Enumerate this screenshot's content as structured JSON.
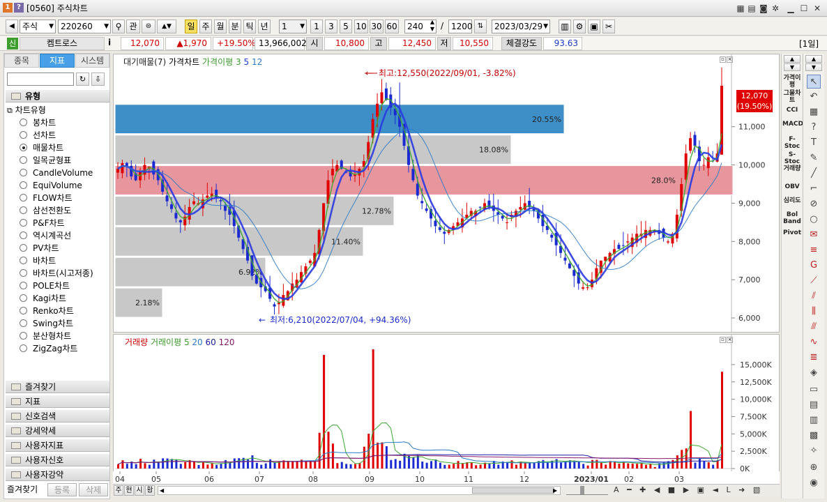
{
  "window": {
    "title": "[0560] 주식차트",
    "icon_1": "1",
    "icon_2": "?",
    "title_buttons": [
      "pin-icon",
      "save-icon",
      "camera-icon",
      "settings-icon",
      "minimize-icon",
      "maximize-icon",
      "close-icon"
    ]
  },
  "toolbar": {
    "market": "주식",
    "code": "220260",
    "search_icon": "search-icon",
    "gwan_label": "관",
    "periods": [
      "일",
      "주",
      "월",
      "분",
      "틱",
      "년"
    ],
    "active_period": "일",
    "interval_value": "1",
    "quick_intervals": [
      "1",
      "3",
      "5",
      "10",
      "30",
      "60"
    ],
    "view_count": "240",
    "slash": "/",
    "total_count": "1200",
    "date": "2023/03/29"
  },
  "info": {
    "badge": "신",
    "name": "켐트로스",
    "info_icon": "i",
    "price": "12,070",
    "change": "▲1,970",
    "change_rate": "+19.50%",
    "volume": "13,966,002",
    "open_label": "시",
    "open": "10,800",
    "high_label": "고",
    "high": "12,450",
    "low_label": "저",
    "low": "10,550",
    "strength_label": "체결강도",
    "strength": "93.63",
    "period_tag": "[1일]"
  },
  "left": {
    "tabs": [
      "종목",
      "지표",
      "시스템"
    ],
    "active_tab": "지표",
    "section_header": "유형",
    "tree_root": "차트유형",
    "chart_types": [
      "봉차트",
      "선차트",
      "매물차트",
      "일목균형표",
      "CandleVolume",
      "EquiVolume",
      "FLOW차트",
      "삼선전환도",
      "P&F차트",
      "역시계곡선",
      "PV차트",
      "바차트",
      "바차트(시고저종)",
      "POLE차트",
      "Kagi차트",
      "Renko차트",
      "Swing차트",
      "분산형차트",
      "ZigZag차트"
    ],
    "selected_type": "매물차트",
    "groups": [
      "즐겨찾기",
      "지표",
      "신호검색",
      "강세약세",
      "사용자지표",
      "사용자신호",
      "사용자강약"
    ],
    "footer_tabs": [
      "즐겨찾기",
      "등록",
      "삭제"
    ]
  },
  "price_legend": {
    "item1": "대기매물(7)",
    "item2": "가격차트",
    "ma_label": "가격이평",
    "ma1": "3",
    "ma2": "5",
    "ma3": "12"
  },
  "volume_legend": {
    "item1": "거래량",
    "ma_label": "거래이평",
    "ma1": "5",
    "ma2": "20",
    "ma3": "60",
    "ma4": "120"
  },
  "annotations": {
    "high": "최고:12,550(2022/09/01, -3.82%)",
    "low": "최저:6,210(2022/07/04, +94.36%)",
    "current_price": "12,070",
    "current_rate": "(19.50%)"
  },
  "right_tools": [
    "가격이평",
    "그물차트",
    "CCI",
    "MACD",
    "F-Stoc",
    "S-Stoc",
    "거래량",
    "OBV",
    "심리도",
    "Bol Band",
    "Pivot"
  ],
  "bottom_tabs": [
    "주",
    "현",
    "시",
    "황"
  ],
  "chart_data": [
    {
      "type": "bar",
      "name": "volume_profile",
      "categories": [
        "6,000-6,800",
        "6,800-7,600",
        "7,600-8,400",
        "8,400-9,200",
        "9,200-10,000",
        "10,000-10,800",
        "10,800-11,600"
      ],
      "values": [
        2.18,
        6.92,
        11.4,
        12.78,
        28.0,
        18.08,
        20.55
      ],
      "value_labels": [
        "2.18%",
        "6.92%",
        "11.40%",
        "12.78%",
        "28.0%",
        "18.08%",
        "20.55%"
      ],
      "highlight": [
        4,
        6
      ],
      "colors": {
        "normal": "#c8c8c8",
        "highlight_current": "#e8969e",
        "highlight_max": "#3e8ec8"
      }
    },
    {
      "type": "line",
      "name": "price",
      "x_ticks": [
        "04",
        "05",
        "06",
        "07",
        "08",
        "09",
        "10",
        "11",
        "12",
        "2023/01",
        "02",
        "03"
      ],
      "y_ticks": [
        "6,000",
        "7,000",
        "8,000",
        "9,000",
        "10,000",
        "11,000"
      ],
      "ylim": [
        5800,
        13000
      ],
      "series": [
        {
          "name": "가격차트",
          "values": [
            9900,
            10050,
            9950,
            9700,
            9600,
            9850,
            10000,
            9950,
            9750,
            9600,
            9300,
            9050,
            8850,
            8600,
            8500,
            8650,
            8900,
            9050,
            9000,
            9100,
            9200,
            9250,
            9150,
            9050,
            8800,
            8700,
            8400,
            8100,
            7800,
            7500,
            7100,
            6900,
            6800,
            6700,
            6500,
            6300,
            6400,
            6600,
            6700,
            6900,
            7000,
            7200,
            7350,
            7500,
            7700,
            8300,
            9000,
            9600,
            9900,
            10000,
            9900,
            9800,
            9700,
            9750,
            9900,
            10100,
            10600,
            11200,
            11600,
            11900,
            11700,
            11500,
            11300,
            11000,
            10500,
            10000,
            9600,
            9200,
            9000,
            8800,
            8600,
            8400,
            8300,
            8200,
            8300,
            8400,
            8500,
            8600,
            8700,
            8800,
            8800,
            8900,
            9000,
            8900,
            8800,
            8700,
            8600,
            8500,
            8700,
            8800,
            8900,
            9000,
            8900,
            8800,
            8600,
            8400,
            8300,
            8100,
            7900,
            7700,
            7500,
            7300,
            7100,
            6900,
            6800,
            6800,
            7000,
            7300,
            7500,
            7600,
            7700,
            7800,
            7800,
            7900,
            8000,
            8100,
            8200,
            8200,
            8300,
            8300,
            8300,
            8200,
            8100,
            8000,
            8200,
            8700,
            9500,
            10300,
            10700,
            10500,
            10100,
            10000,
            10200,
            10100,
            10300,
            12070
          ]
        },
        {
          "name": "가격이평 3"
        },
        {
          "name": "가격이평 5"
        },
        {
          "name": "가격이평 12"
        }
      ]
    },
    {
      "type": "bar",
      "name": "volume",
      "y_ticks": [
        "0K",
        "2,500K",
        "5,000K",
        "7,500K",
        "10,000K",
        "12,500K",
        "15,000K"
      ],
      "ylim": [
        0,
        16500
      ],
      "spikes_k": [
        {
          "x": "08",
          "value": 16400
        },
        {
          "x": "09",
          "value": 17200
        },
        {
          "x": "03",
          "value": 8300
        },
        {
          "x": "03 end",
          "value": 13966
        }
      ],
      "series": [
        {
          "name": "거래량"
        },
        {
          "name": "거래이평 5"
        },
        {
          "name": "거래이평 20"
        },
        {
          "name": "거래이평 60"
        },
        {
          "name": "거래이평 120"
        }
      ]
    }
  ]
}
